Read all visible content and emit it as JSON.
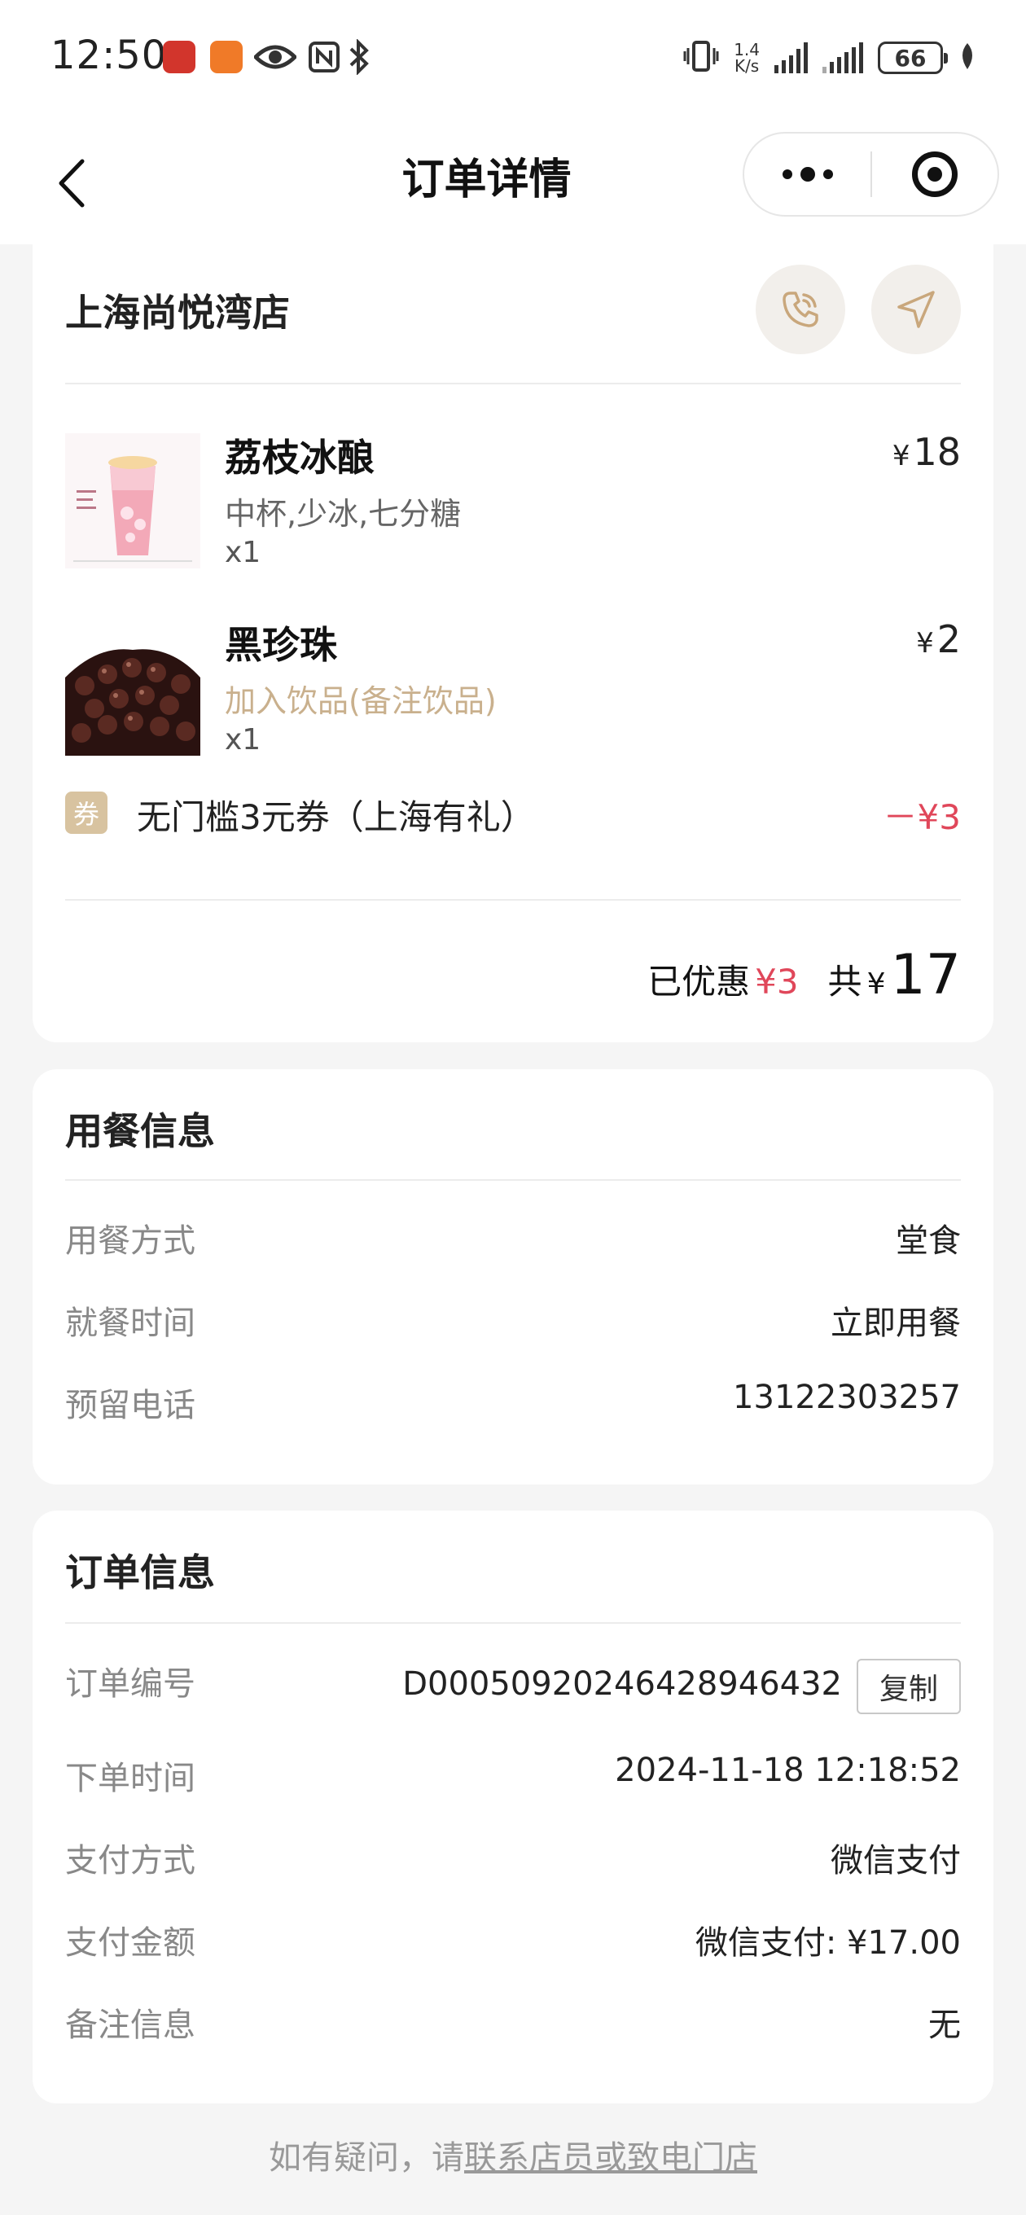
{
  "status_bar": {
    "time": "12:50",
    "net_speed_value": "1.4",
    "net_speed_unit": "K/s",
    "battery": "66",
    "icons": [
      "app-red-icon",
      "app-orange-icon",
      "eye-icon",
      "nfc-icon",
      "bluetooth-icon",
      "vibrate-icon",
      "signal-icon",
      "signal-icon",
      "battery-icon",
      "leaf-icon"
    ]
  },
  "nav": {
    "title": "订单详情",
    "back_icon": "chevron-left-icon",
    "more_icon": "more-dots-icon",
    "close_icon": "target-circle-icon"
  },
  "store": {
    "name": "上海尚悦湾店",
    "phone_icon": "phone-icon",
    "navigate_icon": "navigate-arrow-icon"
  },
  "items": [
    {
      "name": "荔枝冰酿",
      "spec": "中杯,少冰,七分糖",
      "qty": "x1",
      "currency": "¥",
      "price": "18",
      "image": "pink-drink-cup"
    },
    {
      "name": "黑珍珠",
      "spec": "加入饮品(备注饮品)",
      "qty": "x1",
      "currency": "¥",
      "price": "2",
      "image": "black-pearls"
    }
  ],
  "coupon": {
    "badge": "券",
    "name": "无门槛3元券（上海有礼）",
    "amount": "－¥3"
  },
  "summary": {
    "discount_label": "已优惠",
    "discount_value": "¥3",
    "total_label": "共",
    "currency": "¥",
    "total_value": "17"
  },
  "dining": {
    "title": "用餐信息",
    "rows": [
      {
        "label": "用餐方式",
        "value": "堂食"
      },
      {
        "label": "就餐时间",
        "value": "立即用餐"
      },
      {
        "label": "预留电话",
        "value": "13122303257"
      }
    ]
  },
  "order": {
    "title": "订单信息",
    "copy_label": "复制",
    "rows": [
      {
        "label": "订单编号",
        "value": "D000509202464289464​32"
      },
      {
        "label": "下单时间",
        "value": "2024-11-18 12:18:52"
      },
      {
        "label": "支付方式",
        "value": "微信支付"
      },
      {
        "label": "支付金额",
        "value": "微信支付: ¥17.00"
      },
      {
        "label": "备注信息",
        "value": "无"
      }
    ]
  },
  "footer": {
    "prefix": "如有疑问，请",
    "link": "联系店员或致电门店"
  },
  "colors": {
    "accent_red": "#e0475a",
    "gold": "#c9b08d",
    "background": "#f5f5f5"
  }
}
